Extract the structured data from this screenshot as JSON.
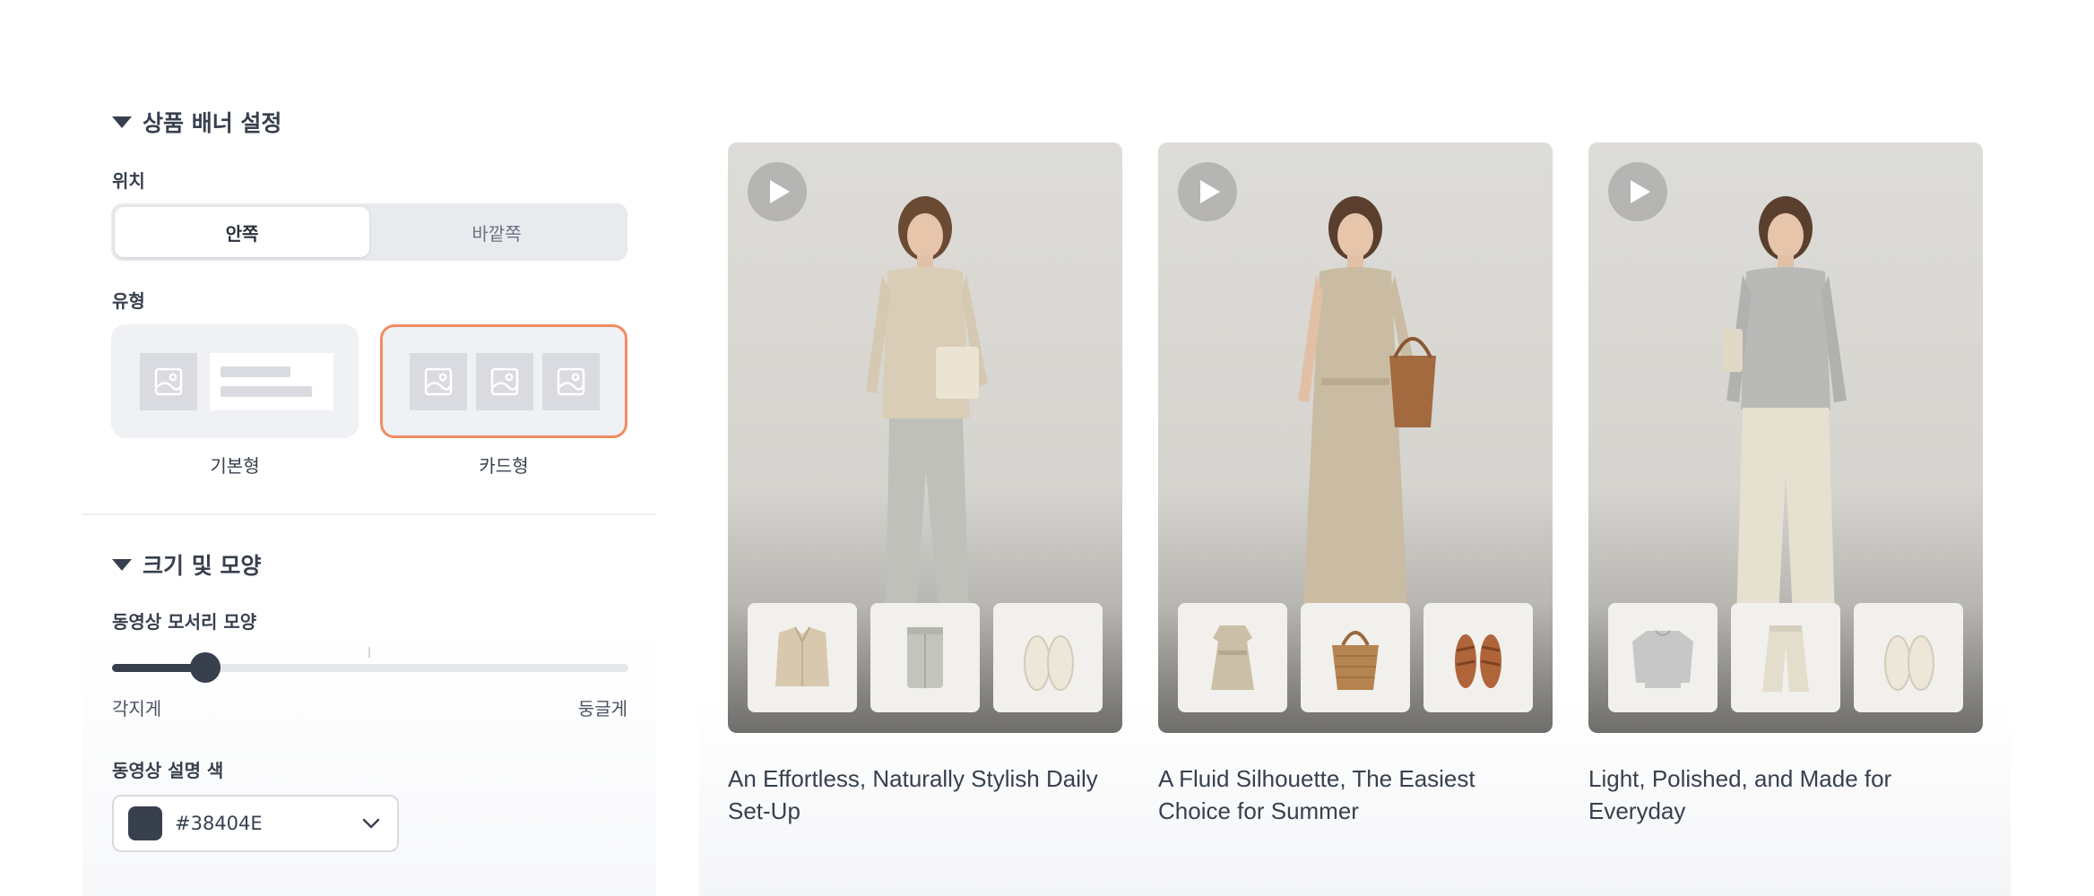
{
  "panel": {
    "banner_section": {
      "title": "상품 배너 설정"
    },
    "position": {
      "label": "위치",
      "options": [
        "안쪽",
        "바깥쪽"
      ],
      "selected": "안쪽"
    },
    "type": {
      "label": "유형",
      "options": [
        "기본형",
        "카드형"
      ],
      "selected": "카드형"
    },
    "size_section": {
      "title": "크기 및 모양"
    },
    "corner": {
      "label": "동영상 모서리 모양",
      "min_label": "각지게",
      "max_label": "둥글게",
      "value_fraction": 0.18
    },
    "caption_color": {
      "label": "동영상 설명 색",
      "value": "#38404E"
    }
  },
  "preview": {
    "cards": [
      {
        "caption": "An Effortless, Naturally Stylish Daily Set-Up",
        "products": [
          "shirt-icon",
          "pants-icon",
          "slip-on-shoes-icon"
        ]
      },
      {
        "caption": "A Fluid Silhouette, The Easiest Choice for Summer",
        "products": [
          "dress-icon",
          "tote-bag-icon",
          "sandals-icon"
        ]
      },
      {
        "caption": "Light, Polished, and Made for Everyday",
        "products": [
          "sweater-icon",
          "wide-pants-icon",
          "slip-on-shoes-icon"
        ]
      }
    ]
  },
  "colors": {
    "accent_selected_border": "#f28c63",
    "text_dark": "#38404E"
  }
}
